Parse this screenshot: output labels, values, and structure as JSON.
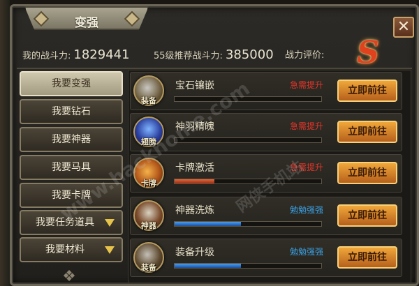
{
  "window": {
    "title": "变强",
    "close_glyph": "✕"
  },
  "stats": {
    "my_power_label": "我的战斗力:",
    "my_power_value": "1829441",
    "recommended_label": "55级推荐战斗力:",
    "recommended_value": "385000",
    "rating_label": "战力评价:",
    "rating_value": "S"
  },
  "menu": [
    {
      "label": "我要变强",
      "active": true
    },
    {
      "label": "我要钻石"
    },
    {
      "label": "我要神器"
    },
    {
      "label": "我要马具"
    },
    {
      "label": "我要卡牌"
    },
    {
      "label": "我要任务道具",
      "has_arrow": true
    },
    {
      "label": "我要材料",
      "has_arrow": true
    }
  ],
  "items": [
    {
      "icon": "equipment-gem-icon",
      "icon_label": "装备",
      "name": "宝石镶嵌",
      "tag": "急需提升",
      "tag_color": "red",
      "progress": 0.0,
      "button": "立即前往"
    },
    {
      "icon": "wings-icon",
      "icon_label": "翅膀",
      "name": "神羽精魄",
      "tag": "急需提升",
      "tag_color": "red",
      "progress": 0.0,
      "button": "立即前往"
    },
    {
      "icon": "card-scroll-icon",
      "icon_label": "卡牌",
      "name": "卡牌激活",
      "tag": "急需提升",
      "tag_color": "red",
      "progress": 0.27,
      "button": "立即前往"
    },
    {
      "icon": "artifact-sword-icon",
      "icon_label": "神器",
      "name": "神器洗炼",
      "tag": "勉勉强强",
      "tag_color": "blue",
      "progress": 0.45,
      "button": "立即前往"
    },
    {
      "icon": "equipment-upgrade-icon",
      "icon_label": "装备",
      "name": "装备升级",
      "tag": "勉勉强强",
      "tag_color": "blue",
      "progress": 0.45,
      "button": "立即前往"
    }
  ],
  "colors": {
    "accent_red": "#e3352a",
    "accent_blue": "#3aa2e6",
    "button_gold": "#f0a73a"
  },
  "watermark": {
    "text": "www.hackhome.com",
    "site": "网侠手机站"
  }
}
